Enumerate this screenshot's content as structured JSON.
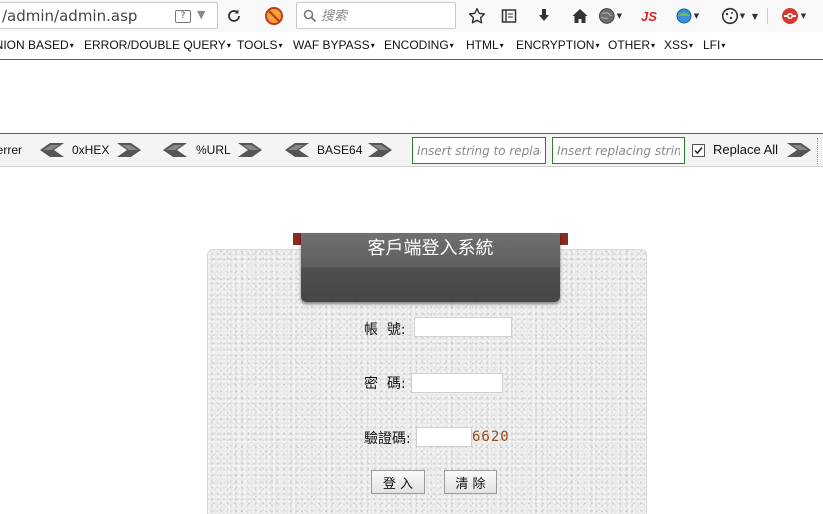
{
  "browser": {
    "url": "/admin/admin.asp",
    "reader_view_label": "?",
    "search_placeholder": "搜索",
    "noscript_label": "JS"
  },
  "hackbar": {
    "menu": [
      {
        "label": "UNION BASED"
      },
      {
        "label": "ERROR/DOUBLE QUERY"
      },
      {
        "label": "TOOLS"
      },
      {
        "label": "WAF BYPASS"
      },
      {
        "label": "ENCODING"
      },
      {
        "label": "HTML"
      },
      {
        "label": "ENCRYPTION"
      },
      {
        "label": "OTHER"
      },
      {
        "label": "XSS"
      },
      {
        "label": "LFI"
      }
    ],
    "referrer_label": "Referrer",
    "hex_label": "0xHEX",
    "url_label": "%URL",
    "base64_label": "BASE64",
    "find_placeholder": "Insert string to replace",
    "replace_placeholder": "Insert replacing string",
    "replace_all_label": "Replace All",
    "replace_all_checked": true
  },
  "login": {
    "title": "客戶端登入系統",
    "username_label": "帳  號:",
    "password_label": "密  碼:",
    "captcha_label": "驗證碼:",
    "captcha_value": "6620",
    "login_button": "登 入",
    "clear_button": "清 除"
  },
  "colors": {
    "hackbar_green": "#2e7d32",
    "ribbon_dark": "#4e4e4e",
    "ribbon_tab": "#8b2a1e",
    "captcha_text": "#9b4a1a"
  }
}
